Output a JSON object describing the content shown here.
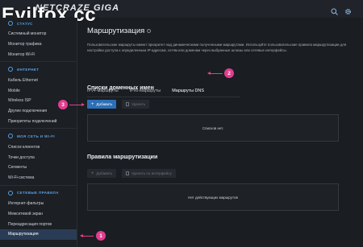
{
  "watermark": "Evilfox.cc",
  "brand": "NETCRAZE GIGA",
  "sidebar": {
    "status": {
      "title": "СТАТУС",
      "items": [
        "Системный монитор",
        "Монитор трафика",
        "Монитор Wi-Fi"
      ]
    },
    "internet": {
      "title": "ИНТЕРНЕТ",
      "items": [
        "Кабель Ethernet",
        "Mobile",
        "Wireless ISP",
        "Другие подключения",
        "Приоритеты подключений"
      ]
    },
    "lan": {
      "title": "МОЯ СЕТЬ И WI-FI",
      "items": [
        "Список клиентов",
        "Точки доступа",
        "Сегменты",
        "Wi-Fi-система"
      ]
    },
    "rules": {
      "title": "СЕТЕВЫЕ ПРАВИЛА",
      "items": [
        "Интернет-фильтры",
        "Межсетевой экран",
        "Переадресация портов",
        "Маршрутизация"
      ]
    }
  },
  "main": {
    "title": "Маршрутизация",
    "description": "Пользовательские маршруты имеют приоритет над динамическими полученными маршрутами. Используйте пользовательские правила маршрутизации для настройки доступа к определенным IP-адресам, сетям или доменам через выбранные шлюзы или сетевые интерфейсы.",
    "tabs": [
      "IPv4-маршруты",
      "IPv6-маршруты",
      "Маршруты DNS"
    ],
    "domains": {
      "title": "Списки доменных имен",
      "add_label": "Добавить",
      "delete_label": "Удалить",
      "empty_text": "Списков нет."
    },
    "routing": {
      "title": "Правила маршрутизации",
      "add_label": "Добавить",
      "delete_label": "Удалить по интерфейсу",
      "empty_text": "Нет действующих маршрутов"
    }
  },
  "annotations": [
    "1",
    "2",
    "3"
  ]
}
